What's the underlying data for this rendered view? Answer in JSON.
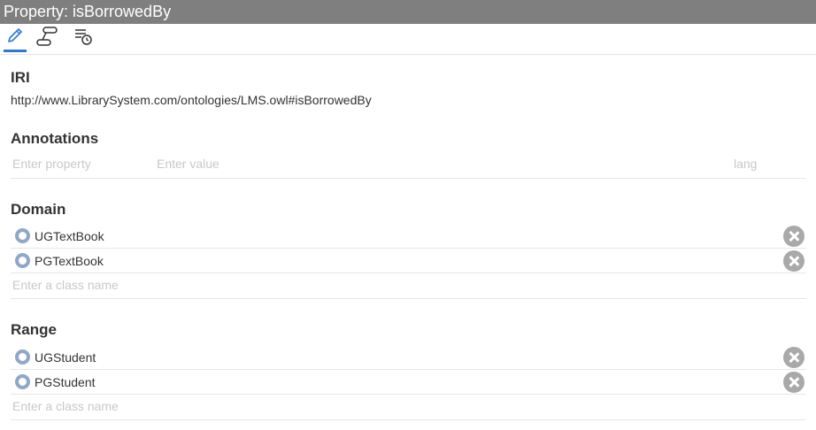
{
  "title": "Property: isBorrowedBy",
  "toolbar": {
    "tools": [
      {
        "icon": "pencil-icon",
        "active": true
      },
      {
        "icon": "hierarchy-icon",
        "active": false
      },
      {
        "icon": "history-icon",
        "active": false
      }
    ]
  },
  "iri": {
    "heading": "IRI",
    "value": "http://www.LibrarySystem.com/ontologies/LMS.owl#isBorrowedBy"
  },
  "annotations": {
    "heading": "Annotations",
    "property_placeholder": "Enter property",
    "value_placeholder": "Enter value",
    "lang_placeholder": "lang"
  },
  "domain": {
    "heading": "Domain",
    "items": [
      {
        "label": "UGTextBook"
      },
      {
        "label": "PGTextBook"
      }
    ],
    "placeholder": "Enter a class name"
  },
  "range": {
    "heading": "Range",
    "items": [
      {
        "label": "UGStudent"
      },
      {
        "label": "PGStudent"
      }
    ],
    "placeholder": "Enter a class name"
  },
  "colors": {
    "titlebar": "#7f7f7f",
    "accent": "#2c78d4",
    "class_icon": "#8fa8c8",
    "remove_button": "#a9a9a9"
  }
}
